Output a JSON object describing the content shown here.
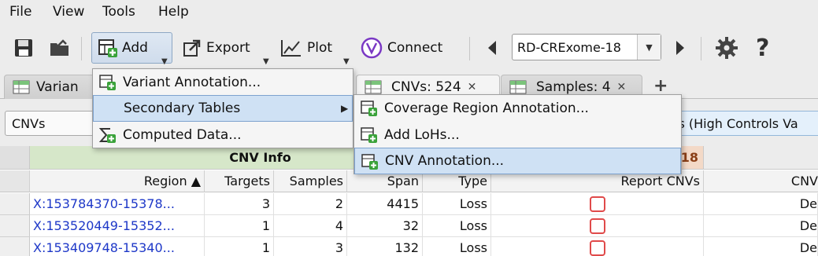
{
  "menubar": {
    "file": "File",
    "view": "View",
    "tools": "Tools",
    "help": "Help"
  },
  "toolbar": {
    "add": "Add",
    "export": "Export",
    "plot": "Plot",
    "connect": "Connect",
    "dataset_selected": "RD-CRExome-18"
  },
  "tabs": [
    {
      "label": "Varian"
    },
    {
      "label": "CNVs: 524"
    },
    {
      "label": "Samples: 4"
    }
  ],
  "filters": {
    "left": "CNVs",
    "right": "is (High Controls Va"
  },
  "add_menu": {
    "items": [
      {
        "label": "Variant Annotation..."
      },
      {
        "label": "Secondary Tables"
      },
      {
        "label": "Computed Data..."
      }
    ]
  },
  "secondary_menu": {
    "items": [
      {
        "label": "Coverage Region Annotation..."
      },
      {
        "label": "Add LoHs..."
      },
      {
        "label": "CNV Annotation..."
      }
    ]
  },
  "table": {
    "group_header": "CNV Info",
    "group_header_right": "18",
    "columns": [
      "Region ▲",
      "Targets",
      "Samples",
      "Span",
      "Type",
      "Report CNVs",
      "CNV"
    ],
    "rows": [
      {
        "region": "X:153784370-15378...",
        "targets": "3",
        "samples": "2",
        "span": "4415",
        "type": "Loss",
        "last": "De"
      },
      {
        "region": "X:153520449-15352...",
        "targets": "1",
        "samples": "4",
        "span": "32",
        "type": "Loss",
        "last": "De"
      },
      {
        "region": "X:153409748-15340...",
        "targets": "1",
        "samples": "3",
        "span": "132",
        "type": "Loss",
        "last": "De"
      }
    ]
  },
  "colors": {
    "accent_green": "#3aa23a",
    "connect_purple": "#7a38c4",
    "link_blue": "#1e38c8",
    "checkbox_red": "#e04a4a",
    "selection_blue": "#cfe1f4"
  }
}
